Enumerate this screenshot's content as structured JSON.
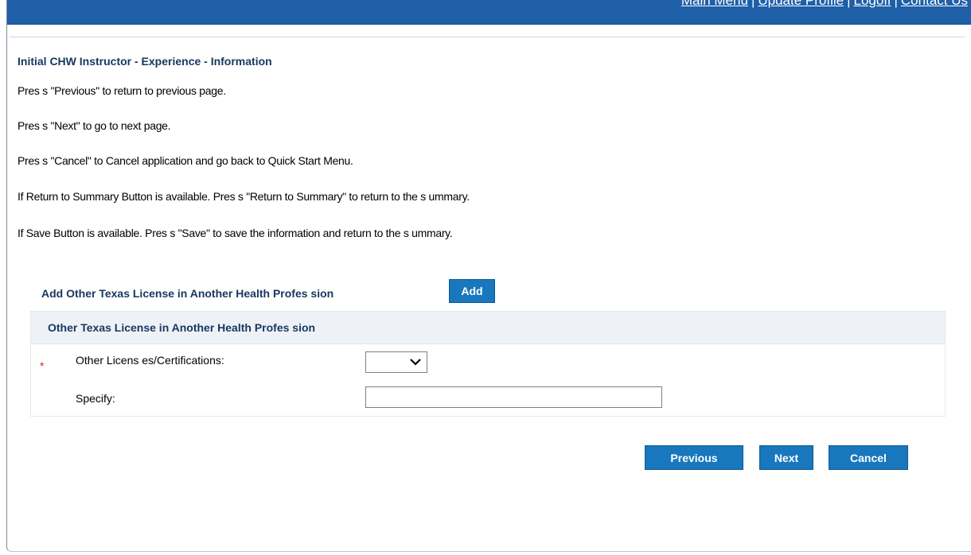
{
  "topnav": {
    "items": [
      "Main Menu",
      "Update Profile",
      "Logoff",
      "Contact Us"
    ],
    "separator": "|"
  },
  "page": {
    "title": "Initial CHW Instructor - Experience - Information",
    "instructions": [
      "Pres s \"Previous\" to return to previous page.",
      "Pres s \"Next\" to go to next page.",
      "Pres s \"Cancel\" to Cancel application and go back to Quick Start Menu.",
      "If Return to Summary Button is available. Pres s \"Return to Summary\" to return to the s ummary.",
      "If Save Button is available. Pres s \"Save\" to save the information and return to the s ummary."
    ]
  },
  "add_section": {
    "label": "Add Other Texas License in Another Health Profes sion",
    "add_button": "Add"
  },
  "panel": {
    "title": "Other Texas License in Another Health Profes sion",
    "required_marker": "*",
    "other_licenses_label": "Other Licens es/Certifications:",
    "other_licenses_value": "",
    "specify_label": "Specify:",
    "specify_value": "",
    "specify_placeholder": ""
  },
  "footer_buttons": {
    "previous": "Previous",
    "next": "Next",
    "cancel": "Cancel"
  },
  "colors": {
    "topbar": "#1e5fa8",
    "button": "#1877bd",
    "heading": "#17375e",
    "required": "#d9261c",
    "panel_header": "#eef2f7"
  },
  "icons": {
    "select_arrow": "chevron-down-icon"
  }
}
